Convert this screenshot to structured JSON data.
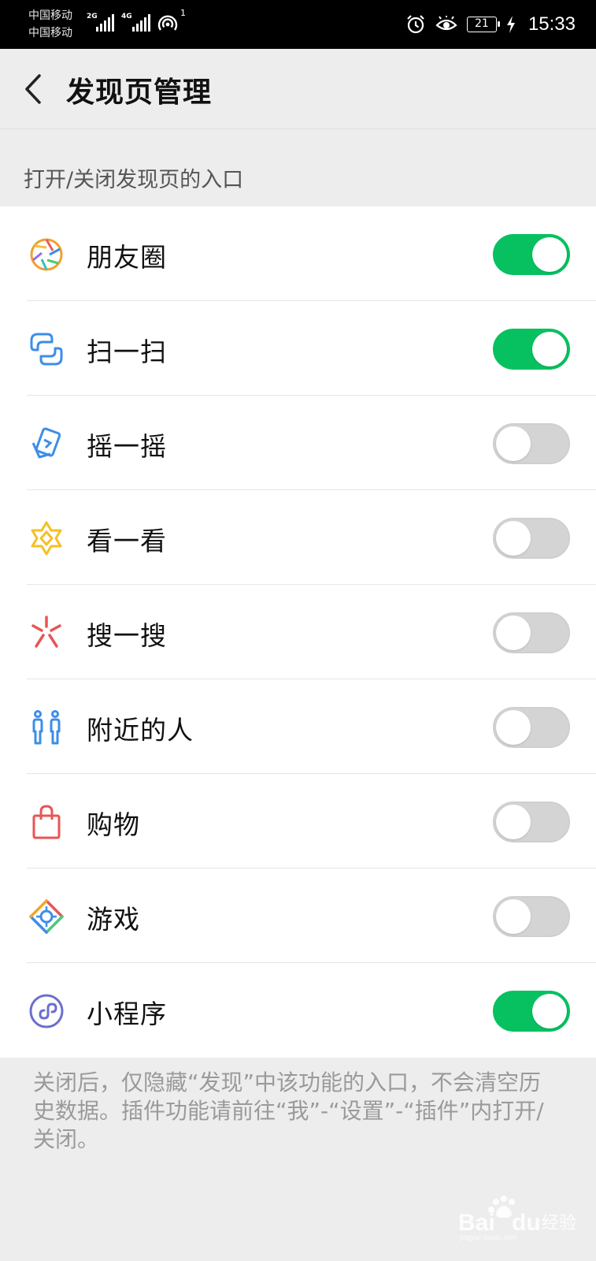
{
  "status_bar": {
    "carrier_1": "中国移动",
    "carrier_2": "中国移动",
    "network_1": "2G",
    "network_2": "4G",
    "hotspot_count": "1",
    "battery": "21",
    "time": "15:33",
    "icons": [
      "alarm-icon",
      "eye-comfort-icon",
      "battery-icon",
      "charging-icon"
    ]
  },
  "header": {
    "title": "发现页管理"
  },
  "section_label": "打开/关闭发现页的入口",
  "items": [
    {
      "label": "朋友圈",
      "icon": "moments-icon",
      "enabled": true
    },
    {
      "label": "扫一扫",
      "icon": "scan-icon",
      "enabled": true
    },
    {
      "label": "摇一摇",
      "icon": "shake-icon",
      "enabled": false
    },
    {
      "label": "看一看",
      "icon": "top-stories-icon",
      "enabled": false
    },
    {
      "label": "搜一搜",
      "icon": "search-icon",
      "enabled": false
    },
    {
      "label": "附近的人",
      "icon": "people-nearby-icon",
      "enabled": false
    },
    {
      "label": "购物",
      "icon": "shopping-icon",
      "enabled": false
    },
    {
      "label": "游戏",
      "icon": "games-icon",
      "enabled": false
    },
    {
      "label": "小程序",
      "icon": "mini-programs-icon",
      "enabled": true
    }
  ],
  "footnote": "关闭后，仅隐藏“发现”中该功能的入口，不会清空历史数据。插件功能请前往“我”-“设置”-“插件”内打开/关闭。",
  "watermark": "Baidu经验",
  "colors": {
    "toggle_on": "#07c160",
    "toggle_off": "#d4d4d4",
    "background": "#ededed"
  }
}
